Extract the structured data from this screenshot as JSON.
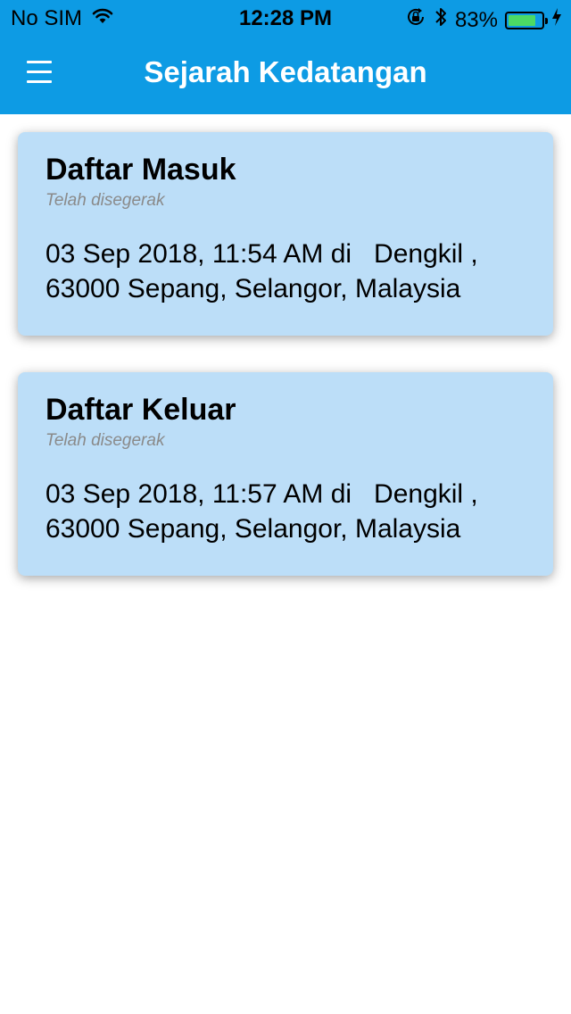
{
  "status_bar": {
    "carrier": "No SIM",
    "time": "12:28 PM",
    "battery_percent": "83%",
    "battery_level": 0.83,
    "wifi_icon": "wifi-icon",
    "orientation_lock_icon": "orientation-lock-icon",
    "bluetooth_icon": "bluetooth-icon",
    "charging_icon": "charging-bolt-icon"
  },
  "header": {
    "title": "Sejarah Kedatangan",
    "menu_icon": "menu-icon",
    "background_color": "#0d9be4"
  },
  "records": [
    {
      "title": "Daftar Masuk",
      "status": "Telah disegerak",
      "detail": "03 Sep 2018, 11:54 AM di   Dengkil , 63000 Sepang, Selangor, Malaysia"
    },
    {
      "title": "Daftar Keluar",
      "status": "Telah disegerak",
      "detail": "03 Sep 2018, 11:57 AM di   Dengkil , 63000 Sepang, Selangor, Malaysia"
    }
  ],
  "colors": {
    "card_background": "#bcdef8",
    "subtitle": "#8a8a8a"
  }
}
